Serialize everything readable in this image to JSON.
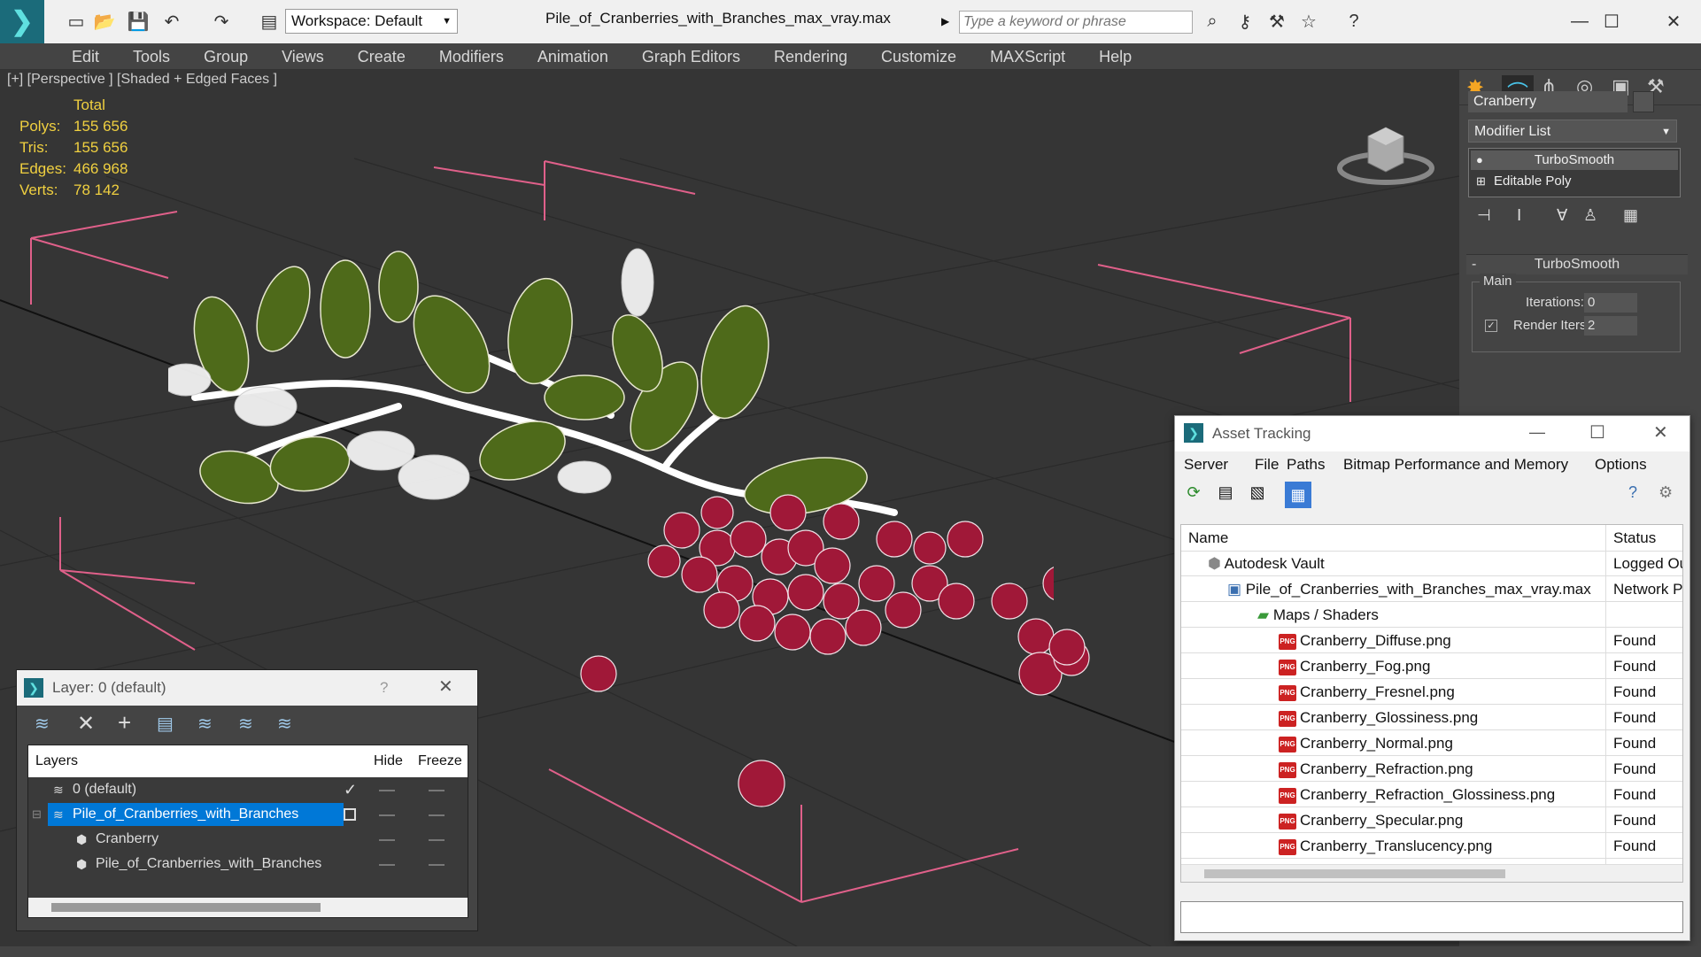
{
  "titlebar": {
    "workspace": "Workspace: Default",
    "filename": "Pile_of_Cranberries_with_Branches_max_vray.max",
    "search_placeholder": "Type a keyword or phrase"
  },
  "menu": [
    "Edit",
    "Tools",
    "Group",
    "Views",
    "Create",
    "Modifiers",
    "Animation",
    "Graph Editors",
    "Rendering",
    "Customize",
    "MAXScript",
    "Help"
  ],
  "viewport": {
    "label": "[+] [Perspective ] [Shaded + Edged Faces ]",
    "stats": {
      "header": "Total",
      "polys_label": "Polys:",
      "polys": "155 656",
      "tris_label": "Tris:",
      "tris": "155 656",
      "edges_label": "Edges:",
      "edges": "466 968",
      "verts_label": "Verts:",
      "verts": "78 142"
    }
  },
  "command_panel": {
    "object_name": "Cranberry",
    "modifier_list": "Modifier List",
    "stack": [
      "TurboSmooth",
      "Editable Poly"
    ],
    "rollout_title": "TurboSmooth",
    "group_main": "Main",
    "iterations_label": "Iterations:",
    "iterations_value": "0",
    "render_iters_label": "Render Iters:",
    "render_iters_value": "2"
  },
  "layer_window": {
    "title": "Layer: 0 (default)",
    "help": "?",
    "col_layers": "Layers",
    "col_hide": "Hide",
    "col_freeze": "Freeze",
    "rows": [
      {
        "name": "0 (default)"
      },
      {
        "name": "Pile_of_Cranberries_with_Branches"
      },
      {
        "name": "Cranberry"
      },
      {
        "name": "Pile_of_Cranberries_with_Branches"
      }
    ]
  },
  "asset_tracking": {
    "title": "Asset Tracking",
    "menu": [
      "Server",
      "File",
      "Paths",
      "Bitmap Performance and Memory",
      "Options"
    ],
    "col_name": "Name",
    "col_status": "Status",
    "rows": [
      {
        "name": "Autodesk Vault",
        "status": "Logged Ou"
      },
      {
        "name": "Pile_of_Cranberries_with_Branches_max_vray.max",
        "status": "Network P"
      },
      {
        "name": "Maps / Shaders",
        "status": ""
      },
      {
        "name": "Cranberry_Diffuse.png",
        "status": "Found"
      },
      {
        "name": "Cranberry_Fog.png",
        "status": "Found"
      },
      {
        "name": "Cranberry_Fresnel.png",
        "status": "Found"
      },
      {
        "name": "Cranberry_Glossiness.png",
        "status": "Found"
      },
      {
        "name": "Cranberry_Normal.png",
        "status": "Found"
      },
      {
        "name": "Cranberry_Refraction.png",
        "status": "Found"
      },
      {
        "name": "Cranberry_Refraction_Glossiness.png",
        "status": "Found"
      },
      {
        "name": "Cranberry_Specular.png",
        "status": "Found"
      },
      {
        "name": "Cranberry_Translucency.png",
        "status": "Found"
      }
    ]
  },
  "colors": {
    "accent": "#0078d7",
    "stat_yellow": "#f0d040",
    "berry": "#a01838",
    "leaf": "#4e6a1a"
  }
}
